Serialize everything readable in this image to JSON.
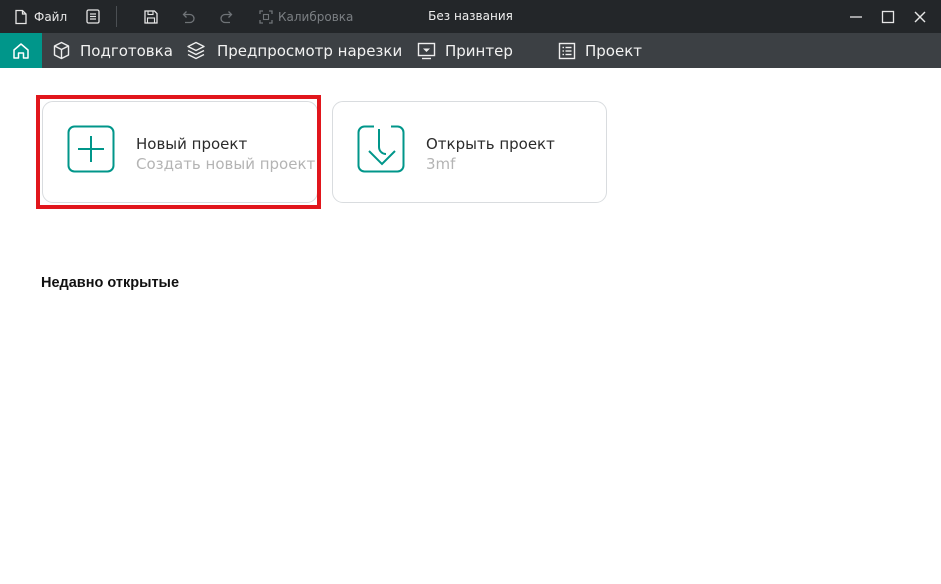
{
  "titlebar": {
    "file_label": "Файл",
    "calibration_label": "Калибровка",
    "window_title": "Без названия"
  },
  "menubar": {
    "tabs": [
      {
        "label": "Подготовка",
        "icon": "cube-icon"
      },
      {
        "label": "Предпросмотр нарезки",
        "icon": "layers-icon"
      },
      {
        "label": "Принтер",
        "icon": "printer-icon"
      },
      {
        "label": "Проект",
        "icon": "list-icon"
      }
    ]
  },
  "cards": {
    "new_project": {
      "title": "Новый проект",
      "subtitle": "Создать новый проект"
    },
    "open_project": {
      "title": "Открыть проект",
      "subtitle": "3mf"
    }
  },
  "recent": {
    "title": "Недавно открытые"
  },
  "colors": {
    "accent": "#00968a",
    "titlebar": "#232629",
    "menubar": "#3c4044",
    "highlight": "#e1161c"
  }
}
